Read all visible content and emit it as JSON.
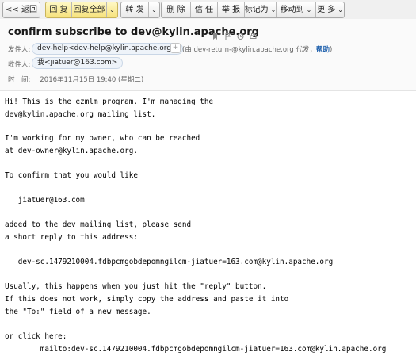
{
  "toolbar": {
    "back_label": "<< 返回",
    "reply_label": "回 复",
    "reply_all_label": "回复全部",
    "forward_label": "转 发",
    "delete_label": "删 除",
    "trust_label": "信 任",
    "report_label": "举 报",
    "mark_as_label": "标记为",
    "move_to_label": "移动到",
    "more_label": "更 多",
    "chevron": "⌄"
  },
  "header": {
    "subject": "confirm subscribe to dev@kylin.apache.org",
    "sender_label": "发件人:",
    "sender": "dev-help<dev-help@kylin.apache.org>",
    "via_prefix": "(由 dev-return-@kylin.apache.org 代发，",
    "help_link": "帮助",
    "via_suffix": ")",
    "recipient_label": "收件人:",
    "recipient": "我<jiatuer@163.com>",
    "time_label": "时　间:",
    "time": "2016年11月15日 19:40 (星期二)",
    "icons": [
      "bookmark-icon",
      "flag-icon",
      "clock-icon",
      "print-icon"
    ]
  },
  "body_lines": [
    "Hi! This is the ezmlm program. I'm managing the",
    "dev@kylin.apache.org mailing list.",
    "I'm working for my owner, who can be reached",
    "at dev-owner@kylin.apache.org.",
    "To confirm that you would like",
    "   jiatuer@163.com",
    "added to the dev mailing list, please send",
    "a short reply to this address:",
    "   dev-sc.1479210004.fdbpcmgobdepomngilcm-jiatuer=163.com@kylin.apache.org",
    "Usually, this happens when you just hit the \"reply\" button.",
    "If this does not work, simply copy the address and paste it into",
    "the \"To:\" field of a new message.",
    "or click here:",
    "        mailto:dev-sc.1479210004.fdbpcmgobdepomngilcm-jiatuer=163.com@kylin.apache.org"
  ]
}
